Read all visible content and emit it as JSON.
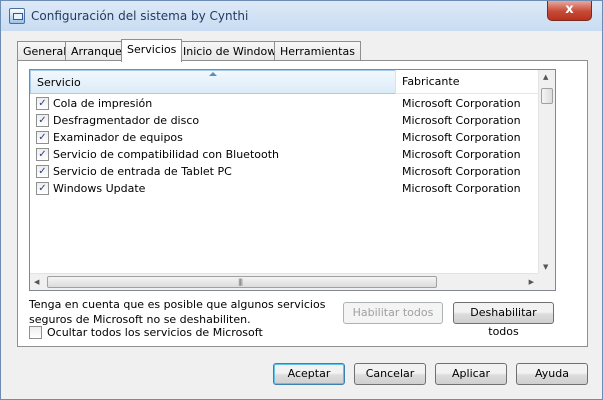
{
  "window": {
    "title": "Configuración del sistema by Cynthi",
    "close_glyph": "x"
  },
  "tabs": [
    {
      "label": "General"
    },
    {
      "label": "Arranque"
    },
    {
      "label": "Servicios"
    },
    {
      "label": "Inicio de Windows"
    },
    {
      "label": "Herramientas"
    }
  ],
  "active_tab": "Servicios",
  "services": {
    "columns": {
      "service": "Servicio",
      "manufacturer": "Fabricante"
    },
    "rows": [
      {
        "checked": true,
        "name": "Cola de impresión",
        "manufacturer": "Microsoft Corporation"
      },
      {
        "checked": true,
        "name": "Desfragmentador de disco",
        "manufacturer": "Microsoft Corporation"
      },
      {
        "checked": true,
        "name": "Examinador de equipos",
        "manufacturer": "Microsoft Corporation"
      },
      {
        "checked": true,
        "name": "Servicio de compatibilidad con Bluetooth",
        "manufacturer": "Microsoft Corporation"
      },
      {
        "checked": true,
        "name": "Servicio de entrada de Tablet PC",
        "manufacturer": "Microsoft Corporation"
      },
      {
        "checked": true,
        "name": "Windows Update",
        "manufacturer": "Microsoft Corporation"
      }
    ]
  },
  "note": {
    "line1": "Tenga en cuenta que es posible que algunos servicios",
    "line2": "seguros de Microsoft no se deshabiliten."
  },
  "buttons": {
    "enable_all": "Habilitar todos",
    "disable_all": "Deshabilitar todos",
    "ok": "Aceptar",
    "cancel": "Cancelar",
    "apply": "Aplicar",
    "help": "Ayuda"
  },
  "hide_ms": {
    "label": "Ocultar todos los servicios de Microsoft",
    "checked": false
  },
  "icons": {
    "checkbox_mark": "✓",
    "app": "msconfig-icon"
  }
}
